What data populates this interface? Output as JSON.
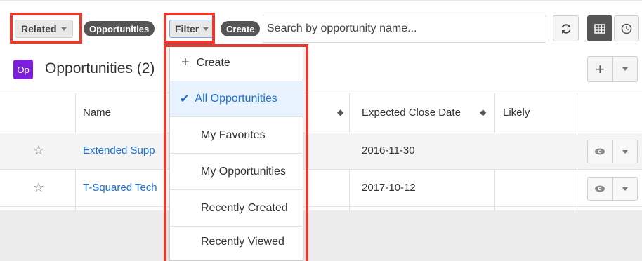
{
  "toolbar": {
    "related_label": "Related",
    "module_pill": "Opportunities",
    "filter_label": "Filter",
    "create_pill": "Create",
    "search_placeholder": "Search by opportunity name...",
    "refresh_icon": "refresh-icon",
    "list_view_icon": "table-grid-icon",
    "activity_view_icon": "clock-icon"
  },
  "header": {
    "badge": "Op",
    "title": "Opportunities (2)",
    "plus": "+",
    "accent_color": "#7c1fdd"
  },
  "table": {
    "columns": [
      "Name",
      "Expected Close Date",
      "Likely"
    ],
    "rows": [
      {
        "name": "Extended Supp",
        "close_date": "2016-11-30"
      },
      {
        "name": "T-Squared Tech",
        "close_date": "2017-10-12"
      }
    ]
  },
  "filter_menu": {
    "create_label": "Create",
    "items": [
      "All Opportunities",
      "My Favorites",
      "My Opportunities",
      "Recently Created",
      "Recently Viewed"
    ],
    "selected": "All Opportunities"
  },
  "highlight_color": "#e8392e"
}
